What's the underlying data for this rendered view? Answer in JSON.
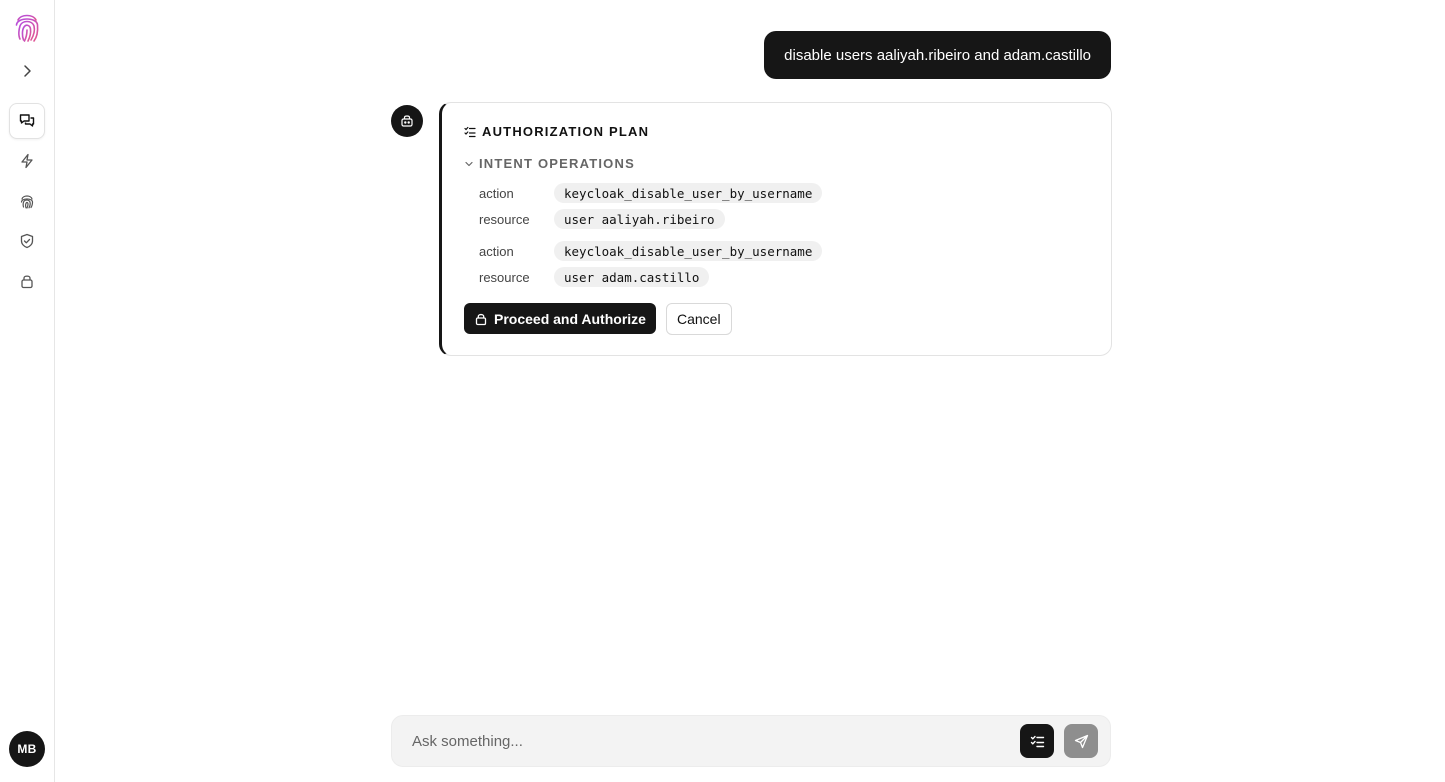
{
  "sidebar": {
    "logo_icon": "fingerprint-logo",
    "items": [
      {
        "name": "expand",
        "icon": "chevron-right-icon"
      },
      {
        "name": "chat",
        "icon": "chat-icon",
        "active": true
      },
      {
        "name": "automations",
        "icon": "lightning-icon"
      },
      {
        "name": "identity",
        "icon": "fingerprint-icon"
      },
      {
        "name": "policies",
        "icon": "shield-check-icon"
      },
      {
        "name": "security",
        "icon": "lock-icon"
      }
    ],
    "avatar_initials": "MB"
  },
  "conversation": {
    "user_message": "disable users aaliyah.ribeiro and adam.castillo",
    "plan": {
      "title": "AUTHORIZATION PLAN",
      "section_label": "INTENT OPERATIONS",
      "operations": [
        {
          "action_key": "action",
          "action": "keycloak_disable_user_by_username",
          "resource_key": "resource",
          "resource": "user aaliyah.ribeiro"
        },
        {
          "action_key": "action",
          "action": "keycloak_disable_user_by_username",
          "resource_key": "resource",
          "resource": "user adam.castillo"
        }
      ],
      "proceed_label": "Proceed and Authorize",
      "cancel_label": "Cancel"
    }
  },
  "composer": {
    "placeholder": "Ask something...",
    "value": ""
  },
  "colors": {
    "primary": "#161616",
    "logo_gradient_start": "#c04fd6",
    "logo_gradient_end": "#e05a9a",
    "send_disabled": "#8e8e8e"
  }
}
